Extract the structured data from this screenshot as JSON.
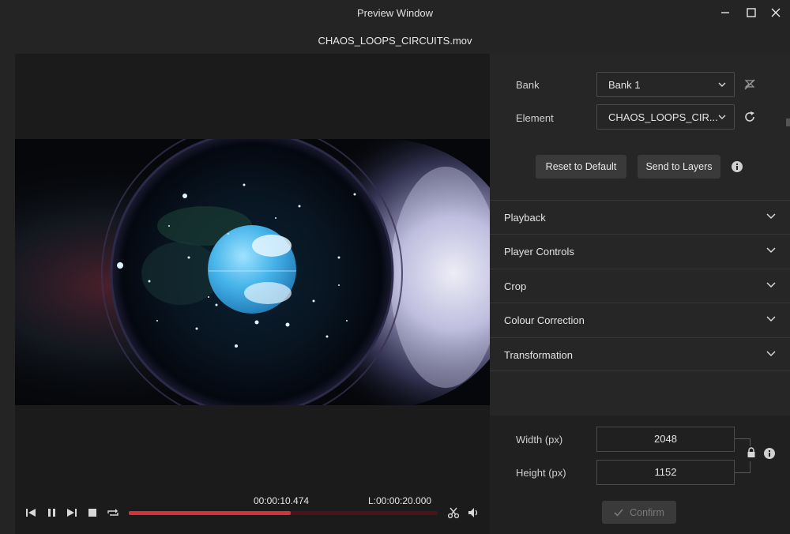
{
  "window": {
    "title": "Preview Window",
    "filename": "CHAOS_LOOPS_CIRCUITS.mov"
  },
  "transport": {
    "current_time": "00:00:10.474",
    "length": "L:00:00:20.000",
    "progress_fraction": 0.5237,
    "accent_color": "#d7323a",
    "icons": [
      "skip-back-icon",
      "pause-icon",
      "skip-forward-icon",
      "stop-icon",
      "loop-icon",
      "scissors-icon",
      "volume-icon"
    ]
  },
  "panel": {
    "bank_label": "Bank",
    "bank_value": "Bank 1",
    "element_label": "Element",
    "element_value": "CHAOS_LOOPS_CIR...",
    "reset_label": "Reset to Default",
    "send_label": "Send to Layers",
    "sections": [
      "Playback",
      "Player Controls",
      "Crop",
      "Colour Correction",
      "Transformation"
    ],
    "width_label": "Width (px)",
    "width_value": "2048",
    "height_label": "Height (px)",
    "height_value": "1152",
    "confirm_label": "Confirm"
  }
}
